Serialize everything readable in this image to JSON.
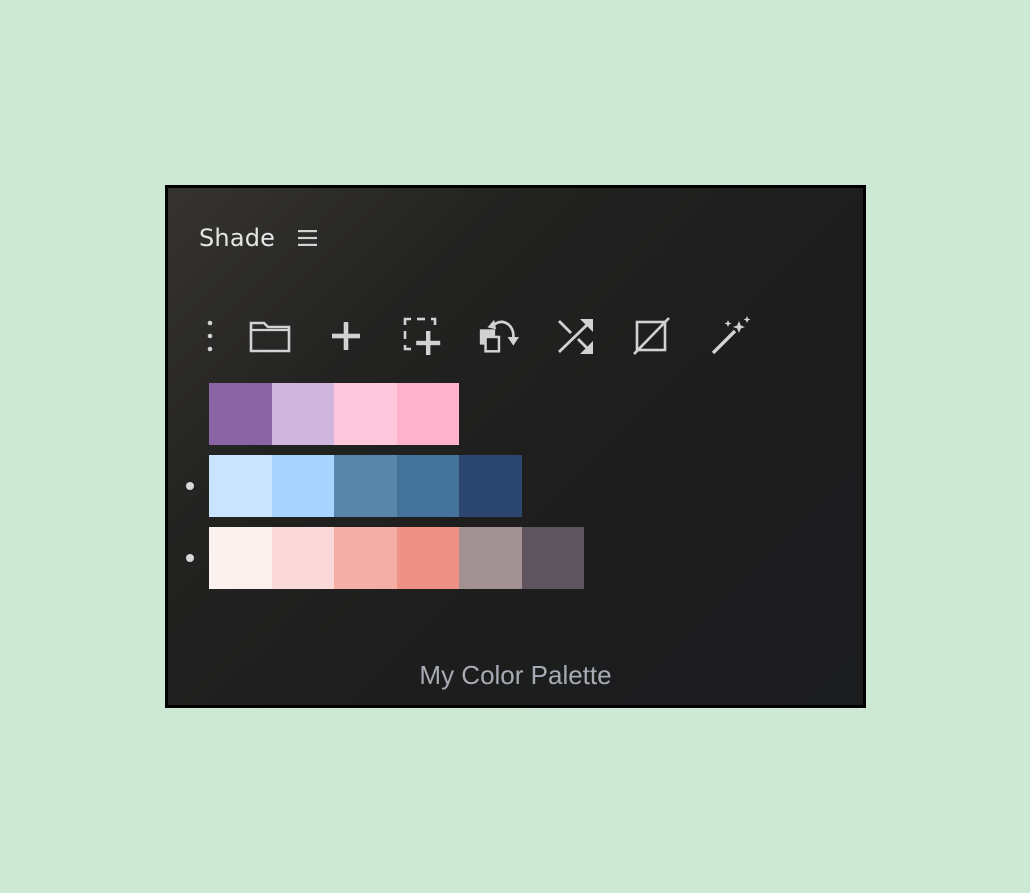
{
  "panel": {
    "title": "Shade",
    "palette_name": "My Color Palette"
  },
  "toolbar": {
    "items": [
      {
        "name": "more-options-icon",
        "label": "More options"
      },
      {
        "name": "folder-icon",
        "label": "Open library"
      },
      {
        "name": "add-icon",
        "label": "Add swatch"
      },
      {
        "name": "add-selection-icon",
        "label": "Add from selection"
      },
      {
        "name": "swap-colors-icon",
        "label": "Swap colors"
      },
      {
        "name": "shuffle-icon",
        "label": "Shuffle"
      },
      {
        "name": "no-color-icon",
        "label": "No color"
      },
      {
        "name": "magic-wand-icon",
        "label": "Generate"
      }
    ]
  },
  "palettes": [
    {
      "marked": false,
      "swatches": [
        "#8a64a5",
        "#cfb6de",
        "#ffc7dc",
        "#ffb2cc"
      ]
    },
    {
      "marked": true,
      "swatches": [
        "#c8e4ff",
        "#a7d3ff",
        "#5a86ab",
        "#43729a",
        "#2b4670"
      ]
    },
    {
      "marked": true,
      "swatches": [
        "#fbf2f0",
        "#fad9d8",
        "#f5aea5",
        "#ef9187",
        "#a19192",
        "#5e545d"
      ]
    }
  ],
  "colors": {
    "background": "#cde9d4",
    "panel": "#1d1d1d",
    "icon": "#d2d2d2",
    "title_text": "#e6e6e6",
    "palette_name_text": "#a7abb3"
  }
}
